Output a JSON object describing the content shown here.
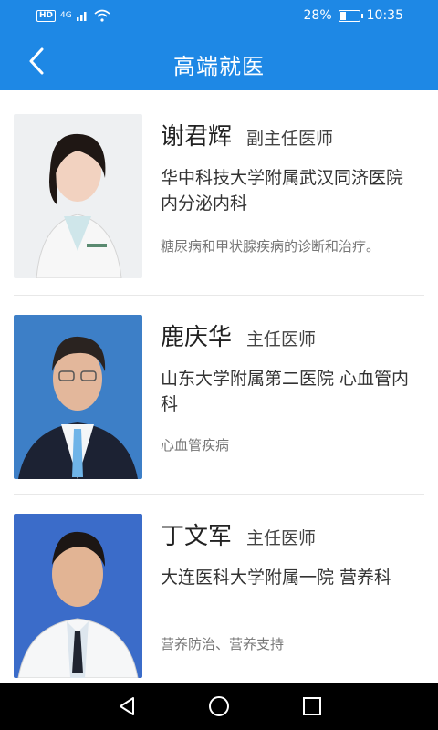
{
  "status": {
    "network": "HD",
    "signal": "4G",
    "battery_pct": "28%",
    "battery_level": 0.28,
    "time": "10:35"
  },
  "appbar": {
    "title": "高端就医",
    "back_icon": "chevron-left-icon"
  },
  "doctors": [
    {
      "name": "谢君辉",
      "title": "副主任医师",
      "hospital": "华中科技大学附属武汉同济医院 内分泌内科",
      "specialty": "糖尿病和甲状腺疾病的诊断和治疗。"
    },
    {
      "name": "鹿庆华",
      "title": "主任医师",
      "hospital": "山东大学附属第二医院 心血管内科",
      "specialty": "心血管疾病"
    },
    {
      "name": "丁文军",
      "title": "主任医师",
      "hospital": "大连医科大学附属一院 营养科",
      "specialty": "营养防治、营养支持"
    }
  ],
  "nav": {
    "back": "triangle-back-icon",
    "home": "circle-home-icon",
    "recent": "square-recent-icon"
  },
  "colors": {
    "primary": "#1e88e5",
    "navbar": "#000000"
  }
}
